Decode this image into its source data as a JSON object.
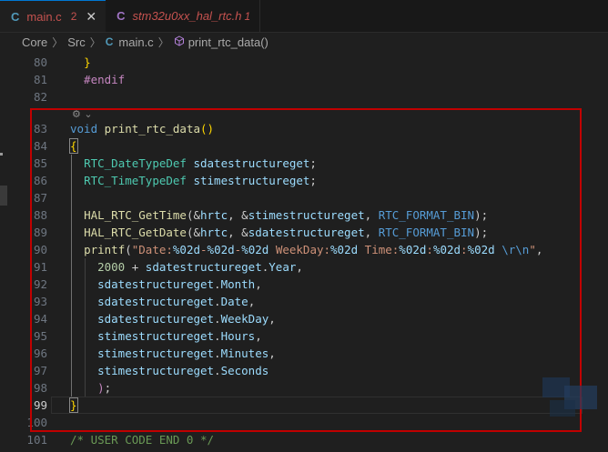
{
  "tabs": [
    {
      "icon": "C",
      "label": "main.c",
      "badge": "2",
      "close": "✕",
      "active": true
    },
    {
      "icon": "C",
      "label": "stm32u0xx_hal_rtc.h",
      "badge": "1",
      "active": false
    }
  ],
  "breadcrumb": {
    "items": [
      "Core",
      "Src"
    ],
    "file_icon": "C",
    "file": "main.c",
    "symbol_icon": "cube-icon",
    "symbol": "print_rtc_data()"
  },
  "codelens": "⚙︎ ⌄",
  "code": [
    {
      "ln": "80",
      "tokens": [
        [
          "p",
          "  "
        ],
        [
          "brace",
          "}"
        ]
      ]
    },
    {
      "ln": "81",
      "tokens": [
        [
          "ctrl",
          "  #endif"
        ]
      ]
    },
    {
      "ln": "82",
      "tokens": []
    },
    {
      "ln": "83",
      "tokens": [
        [
          "kw",
          "void"
        ],
        [
          "p",
          " "
        ],
        [
          "fn",
          "print_rtc_data"
        ],
        [
          "brace",
          "()"
        ]
      ]
    },
    {
      "ln": "84",
      "tokens": [
        [
          "brace",
          "{"
        ]
      ]
    },
    {
      "ln": "85",
      "tokens": [
        [
          "p",
          "  "
        ],
        [
          "type",
          "RTC_DateTypeDef"
        ],
        [
          "p",
          " "
        ],
        [
          "var",
          "sdatestructureget"
        ],
        [
          "p",
          ";"
        ]
      ]
    },
    {
      "ln": "86",
      "tokens": [
        [
          "p",
          "  "
        ],
        [
          "type",
          "RTC_TimeTypeDef"
        ],
        [
          "p",
          " "
        ],
        [
          "var",
          "stimestructureget"
        ],
        [
          "p",
          ";"
        ]
      ]
    },
    {
      "ln": "87",
      "tokens": []
    },
    {
      "ln": "88",
      "tokens": [
        [
          "p",
          "  "
        ],
        [
          "fn",
          "HAL_RTC_GetTime"
        ],
        [
          "p",
          "(&"
        ],
        [
          "var",
          "hrtc"
        ],
        [
          "p",
          ", &"
        ],
        [
          "var",
          "stimestructureget"
        ],
        [
          "p",
          ", "
        ],
        [
          "mac",
          "RTC_FORMAT_BIN"
        ],
        [
          "p",
          ");"
        ]
      ]
    },
    {
      "ln": "89",
      "tokens": [
        [
          "p",
          "  "
        ],
        [
          "fn",
          "HAL_RTC_GetDate"
        ],
        [
          "p",
          "(&"
        ],
        [
          "var",
          "hrtc"
        ],
        [
          "p",
          ", &"
        ],
        [
          "var",
          "sdatestructureget"
        ],
        [
          "p",
          ", "
        ],
        [
          "mac",
          "RTC_FORMAT_BIN"
        ],
        [
          "p",
          ");"
        ]
      ]
    },
    {
      "ln": "90",
      "tokens": [
        [
          "p",
          "  "
        ],
        [
          "fn",
          "printf"
        ],
        [
          "p",
          "("
        ],
        [
          "str",
          "\"Date:"
        ],
        [
          "fmt",
          "%02d"
        ],
        [
          "str",
          "-"
        ],
        [
          "fmt",
          "%02d"
        ],
        [
          "str",
          "-"
        ],
        [
          "fmt",
          "%02d"
        ],
        [
          "str",
          " WeekDay:"
        ],
        [
          "fmt",
          "%02d"
        ],
        [
          "str",
          " Time:"
        ],
        [
          "fmt",
          "%02d"
        ],
        [
          "str",
          ":"
        ],
        [
          "fmt",
          "%02d"
        ],
        [
          "str",
          ":"
        ],
        [
          "fmt",
          "%02d"
        ],
        [
          "str",
          " "
        ],
        [
          "mac",
          "\\r\\n"
        ],
        [
          "str",
          "\""
        ],
        [
          "p",
          ","
        ]
      ]
    },
    {
      "ln": "91",
      "tokens": [
        [
          "p",
          "    "
        ],
        [
          "num",
          "2000"
        ],
        [
          "p",
          " + "
        ],
        [
          "var",
          "sdatestructureget"
        ],
        [
          "p",
          "."
        ],
        [
          "var",
          "Year"
        ],
        [
          "p",
          ","
        ]
      ]
    },
    {
      "ln": "92",
      "tokens": [
        [
          "p",
          "    "
        ],
        [
          "var",
          "sdatestructureget"
        ],
        [
          "p",
          "."
        ],
        [
          "var",
          "Month"
        ],
        [
          "p",
          ","
        ]
      ]
    },
    {
      "ln": "93",
      "tokens": [
        [
          "p",
          "    "
        ],
        [
          "var",
          "sdatestructureget"
        ],
        [
          "p",
          "."
        ],
        [
          "var",
          "Date"
        ],
        [
          "p",
          ","
        ]
      ]
    },
    {
      "ln": "94",
      "tokens": [
        [
          "p",
          "    "
        ],
        [
          "var",
          "sdatestructureget"
        ],
        [
          "p",
          "."
        ],
        [
          "var",
          "WeekDay"
        ],
        [
          "p",
          ","
        ]
      ]
    },
    {
      "ln": "95",
      "tokens": [
        [
          "p",
          "    "
        ],
        [
          "var",
          "stimestructureget"
        ],
        [
          "p",
          "."
        ],
        [
          "var",
          "Hours"
        ],
        [
          "p",
          ","
        ]
      ]
    },
    {
      "ln": "96",
      "tokens": [
        [
          "p",
          "    "
        ],
        [
          "var",
          "stimestructureget"
        ],
        [
          "p",
          "."
        ],
        [
          "var",
          "Minutes"
        ],
        [
          "p",
          ","
        ]
      ]
    },
    {
      "ln": "97",
      "tokens": [
        [
          "p",
          "    "
        ],
        [
          "var",
          "stimestructureget"
        ],
        [
          "p",
          "."
        ],
        [
          "var",
          "Seconds"
        ]
      ]
    },
    {
      "ln": "98",
      "tokens": [
        [
          "p",
          "    "
        ],
        [
          "ctrl",
          ")"
        ],
        [
          "p",
          ";"
        ]
      ]
    },
    {
      "ln": "99",
      "tokens": [
        [
          "brace",
          "}"
        ]
      ],
      "current": true
    },
    {
      "ln": "100",
      "tokens": []
    },
    {
      "ln": "101",
      "tokens": [
        [
          "cmt",
          "/* USER CODE END 0 */"
        ]
      ]
    }
  ],
  "colors": {
    "highlight_box": "#c10000",
    "active_tab_border": "#0078d4",
    "error_text": "#c5524f"
  }
}
